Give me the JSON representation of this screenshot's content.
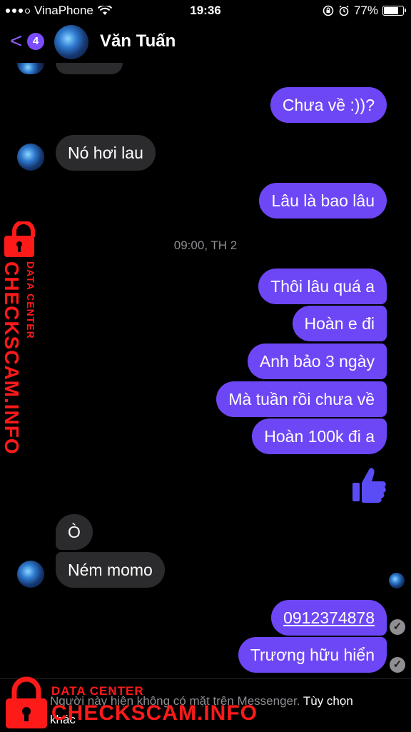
{
  "status_bar": {
    "carrier": "VinaPhone",
    "time": "19:36",
    "battery": "77%"
  },
  "header": {
    "badge_count": "4",
    "contact_name": "Văn Tuấn"
  },
  "messages": {
    "m1": "Chưa về :))?",
    "m2": "Nó hơi lau",
    "m3": "Lâu là bao lâu",
    "timestamp": "09:00, TH 2",
    "m4": "Thôi lâu quá a",
    "m5": "Hoàn e đi",
    "m6": "Anh bảo 3 ngày",
    "m7": "Mà tuần rồi chưa về",
    "m8": "Hoàn 100k đi a",
    "m9": "Ò",
    "m10": "Ném momo",
    "m11": "0912374878",
    "m12": "Trương hữu hiển"
  },
  "footer": {
    "text": "Người này hiện không có mặt trên Messenger.",
    "link": "Tùy chọn khác"
  },
  "watermark": {
    "line1": "DATA CENTER",
    "line2": "CHECKSCAM.INFO"
  },
  "colors": {
    "outgoing": "#6d47f5",
    "incoming": "#2b2b2d",
    "accent": "#8a5cf6",
    "watermark": "#ff1a1a"
  }
}
